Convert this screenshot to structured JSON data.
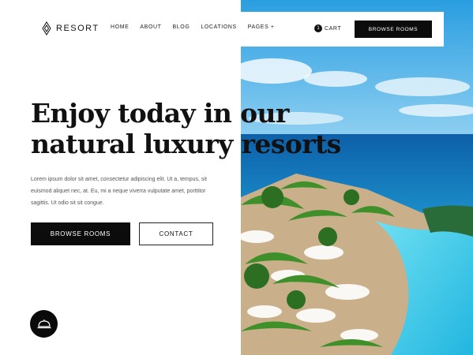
{
  "brand": {
    "name": "RESORT",
    "icon": "logo-diamond-icon"
  },
  "nav": {
    "links": [
      "HOME",
      "ABOUT",
      "BLOG",
      "LOCATIONS",
      "PAGES +"
    ],
    "cart_count": "1",
    "cart_label": "CART",
    "cta_label": "BROWSE ROOMS"
  },
  "hero": {
    "headline_line1": "Enjoy today in our",
    "headline_line2": "natural luxury resorts",
    "body": "Lorem ipsum dolor sit amet, consectetur adipiscing elit. Ut a, tempus, sit euismod aliquet nec, at. Eu, mi a neque viverra vulputate amet, porttitor sagittis. Ut odio sit sit congue.",
    "primary_button": "BROWSE ROOMS",
    "secondary_button": "CONTACT",
    "image": "resort-aerial-pool-palms"
  },
  "floating": {
    "icon": "concierge-bell-icon"
  },
  "colors": {
    "dark": "#0c0c0c",
    "sea": "#1f8fc4",
    "pool": "#3fc4e6"
  }
}
